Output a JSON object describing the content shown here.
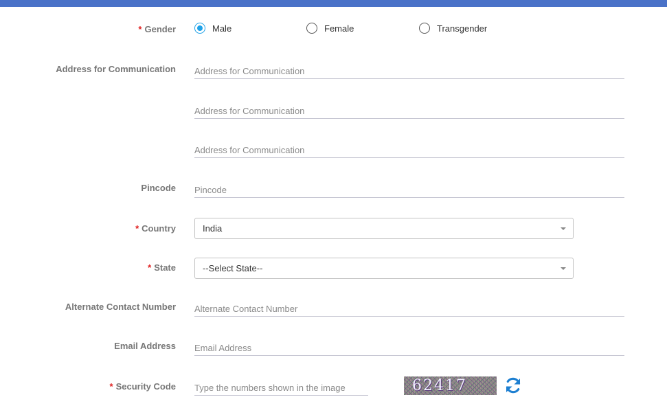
{
  "form": {
    "required_marker": "*",
    "gender": {
      "label": "Gender",
      "options": [
        {
          "label": "Male",
          "selected": true
        },
        {
          "label": "Female",
          "selected": false
        },
        {
          "label": "Transgender",
          "selected": false
        }
      ]
    },
    "address": {
      "label": "Address for Communication",
      "placeholders": [
        "Address for Communication",
        "Address for Communication",
        "Address for Communication"
      ]
    },
    "pincode": {
      "label": "Pincode",
      "placeholder": "Pincode"
    },
    "country": {
      "label": "Country",
      "value": "India"
    },
    "state": {
      "label": "State",
      "value": "--Select State--"
    },
    "alt_contact": {
      "label": "Alternate Contact Number",
      "placeholder": "Alternate Contact Number"
    },
    "email": {
      "label": "Email Address",
      "placeholder": "Email Address"
    },
    "security": {
      "label": "Security Code",
      "placeholder": "Type the numbers shown in the image",
      "captcha_text": "62417"
    }
  },
  "icons": {
    "refresh": "refresh-icon",
    "dropdown": "chevron-down-icon"
  },
  "colors": {
    "accent": "#1fa2e8",
    "topbar": "#4a72c8",
    "required": "#e02020",
    "label": "#777777",
    "refresh": "#1d7fd1"
  }
}
